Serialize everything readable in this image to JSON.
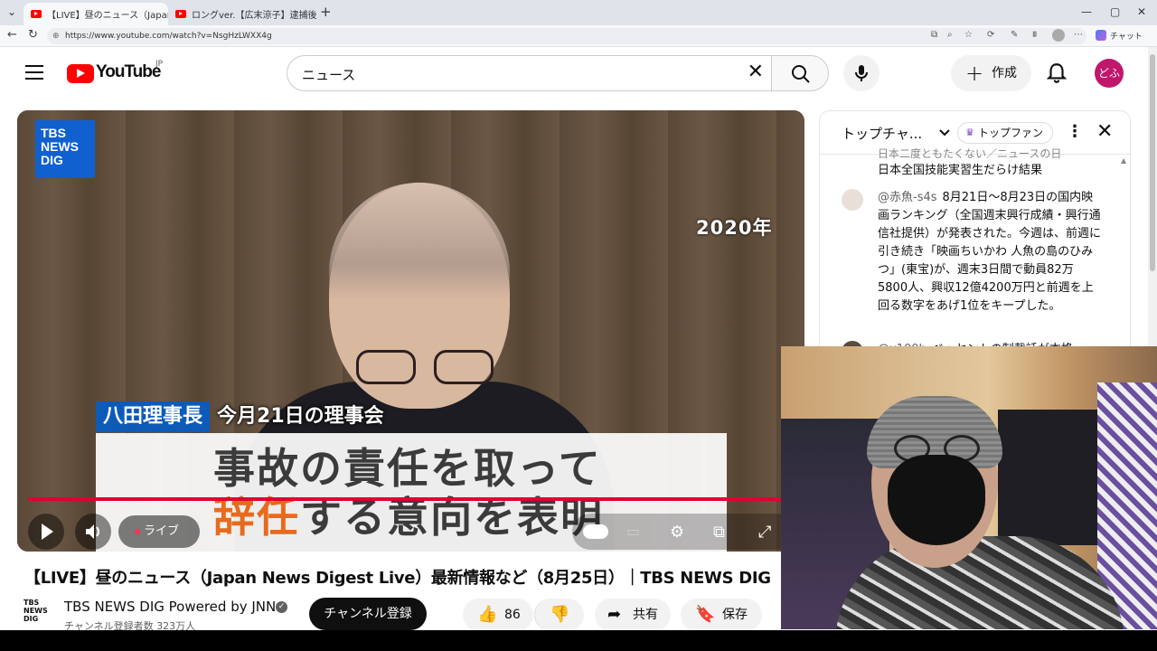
{
  "browser": {
    "tabs": [
      {
        "title": "【LIVE】昼のニュース（Japan News",
        "active": true
      },
      {
        "title": "ロングver.【広末涼子】逮捕後初"
      }
    ],
    "url": "https://www.youtube.com/watch?v=NsgHzLWXX4g",
    "profile_label": "チャット"
  },
  "header": {
    "logo_text": "YouTube",
    "region": "JP",
    "search_value": "ニュース",
    "create_label": "作成",
    "avatar_text": "どふ"
  },
  "player": {
    "channel_logo": [
      "TBS",
      "NEWS",
      "DIG"
    ],
    "year_overlay": "2020年",
    "name_box": "八田理事長",
    "name_text": "今月21日の理事会",
    "caption_line1": "事故の責任を取って",
    "caption_line2_highlight": "辞任",
    "caption_line2_rest": "する意向を表明",
    "live_label": "ライブ",
    "progress": 1.0
  },
  "video": {
    "title": "【LIVE】昼のニュース（Japan News Digest Live）最新情報など（8月25日）｜TBS NEWS DIG",
    "channel_name": "TBS NEWS DIG Powered by JNN",
    "channel_logo_text": [
      "TBS",
      "NEWS",
      "DIG"
    ],
    "subscribers": "チャンネル登録者数 323万人",
    "subscribe_label": "チャンネル登録",
    "like_count": "86",
    "share_label": "共有",
    "save_label": "保存"
  },
  "chat": {
    "title": "トップチャ...",
    "topfan_label": "トップファン",
    "messages": [
      {
        "author": "",
        "text": "日本全国技能実習生だらけ結果",
        "partial_top": "日本二度ともたくない／ニュースの日"
      },
      {
        "author": "@赤魚-s4s",
        "text": "8月21日〜8月23日の国内映画ランキング（全国週末興行成績・興行通信社提供）が発表された。今週は、前週に引き続き「映画ちいかわ 人魚の島のひみつ」(東宝)が、週末3日間で動員82万5800人、興収12億4200万円と前週を上回る数字をあげ1位をキープした。"
      },
      {
        "author": "@x100b",
        "text": "ベッセントの制裁話が本格"
      }
    ]
  },
  "colors": {
    "youtube_red": "#ff0000",
    "progress_red": "#e00034",
    "tbs_blue": "#1060d0",
    "caption_highlight": "#e86a1c",
    "avatar_bg": "#c0176c"
  }
}
